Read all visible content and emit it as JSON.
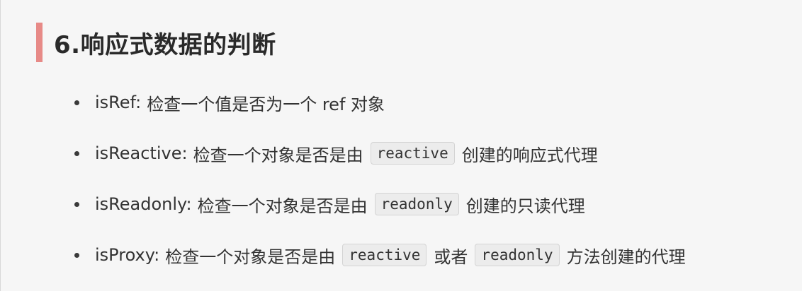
{
  "heading": {
    "title": "6.响应式数据的判断",
    "accent_color": "#e78a87"
  },
  "items": [
    {
      "term": "isRef:",
      "desc": "检查一个值是否为一个 ref 对象"
    },
    {
      "term": "isReactive:",
      "desc": "检查一个对象是否是由",
      "code1": "reactive",
      "after": "创建的响应式代理"
    },
    {
      "term": "isReadonly:",
      "desc": "检查一个对象是否是由",
      "code1": "readonly",
      "after": "创建的只读代理"
    },
    {
      "term": "isProxy:",
      "desc": "检查一个对象是否是由",
      "code1": "reactive",
      "mid": "或者",
      "code2": "readonly",
      "after": "方法创建的代理"
    }
  ]
}
